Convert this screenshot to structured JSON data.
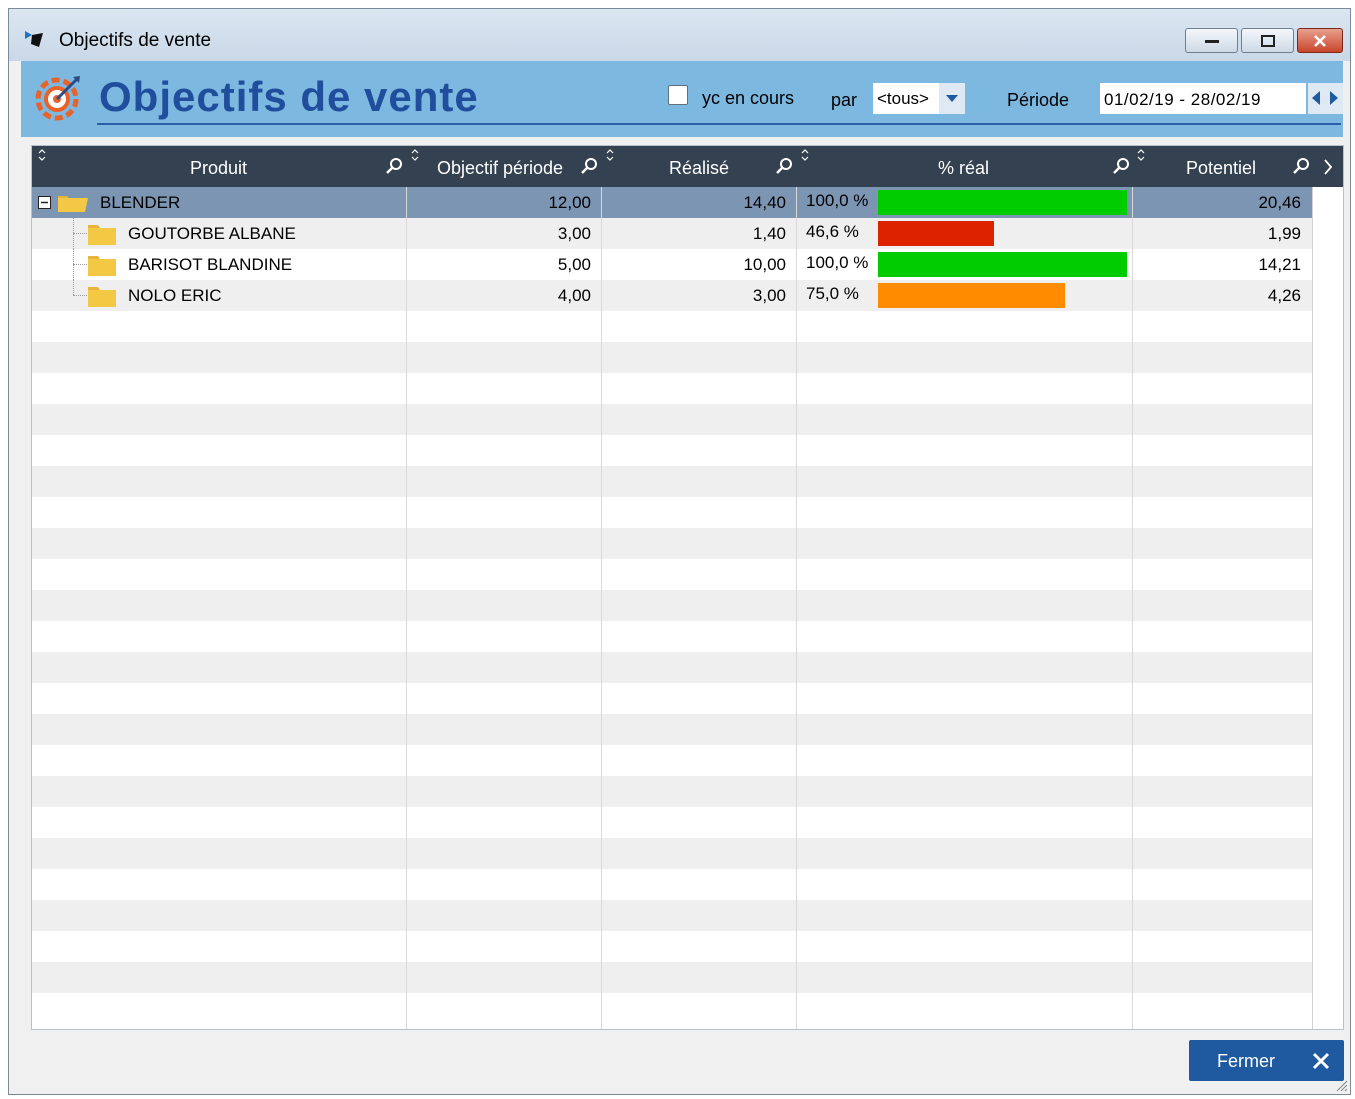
{
  "window": {
    "title": "Objectifs de vente"
  },
  "header": {
    "title": "Objectifs de vente",
    "include_current_label": "yc en cours",
    "include_current_checked": false,
    "par_label": "par",
    "par_value": "<tous>",
    "periode_label": "Période",
    "periode_value": "01/02/19 - 28/02/19"
  },
  "grid": {
    "columns": [
      "Produit",
      "Objectif période",
      "Réalisé",
      "% réal",
      "Potentiel"
    ],
    "rows": [
      {
        "produit": "BLENDER",
        "objectif": "12,00",
        "realise": "14,40",
        "pct_text": "100,0 %",
        "pct": 1.0,
        "potentiel": "20,46",
        "level": 0,
        "selected": true,
        "bar_color": "#00cc00"
      },
      {
        "produit": "GOUTORBE ALBANE",
        "objectif": "3,00",
        "realise": "1,40",
        "pct_text": "46,6 %",
        "pct": 0.466,
        "potentiel": "1,99",
        "level": 1,
        "selected": false,
        "bar_color": "#dd2200"
      },
      {
        "produit": "BARISOT BLANDINE",
        "objectif": "5,00",
        "realise": "10,00",
        "pct_text": "100,0 %",
        "pct": 1.0,
        "potentiel": "14,21",
        "level": 1,
        "selected": false,
        "bar_color": "#00cc00"
      },
      {
        "produit": "NOLO ERIC",
        "objectif": "4,00",
        "realise": "3,00",
        "pct_text": "75,0 %",
        "pct": 0.75,
        "potentiel": "4,26",
        "level": 1,
        "selected": false,
        "bar_color": "#ff8c00"
      }
    ]
  },
  "footer": {
    "close_label": "Fermer"
  },
  "colors": {
    "header_bg": "#7db8e0",
    "title_blue": "#1f4e9c",
    "grid_header_bg": "#344150",
    "button_bg": "#1f5aa0"
  },
  "icons": [
    "target-icon",
    "folder-icon",
    "search-icon",
    "sort-icon",
    "close-icon",
    "minimize-icon",
    "maximize-icon",
    "collapse-icon"
  ]
}
